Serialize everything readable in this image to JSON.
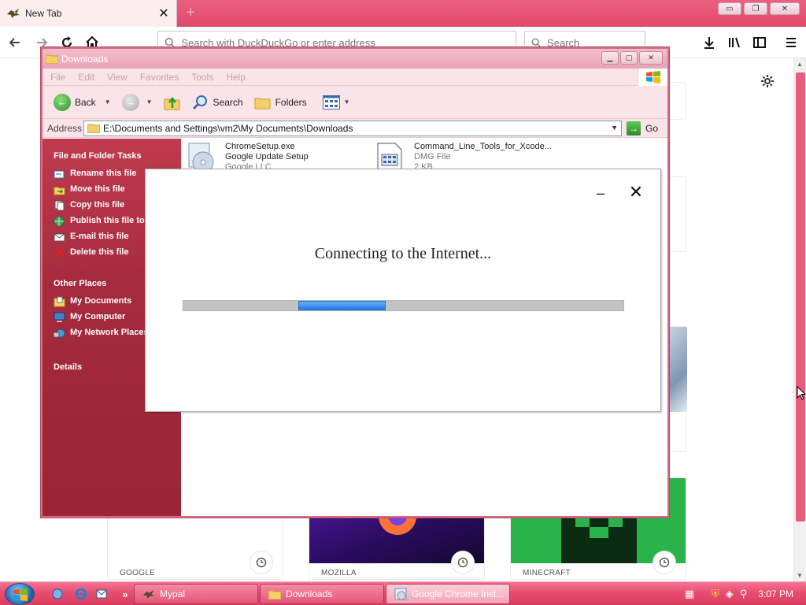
{
  "browser": {
    "tab_title": "New Tab",
    "tab_close": "✕",
    "new_tab": "+",
    "url_placeholder": "Search with DuckDuckGo or enter address",
    "search_placeholder": "Search",
    "window_controls": {
      "minimize": "▭",
      "restore": "❐",
      "close": "✕"
    }
  },
  "newtab": {
    "tiles": [
      {
        "label": "GOOGLE",
        "bg": "#ffffff"
      },
      {
        "label": "MOZILLA",
        "bg": "#3b1066"
      },
      {
        "label": "MINECRAFT",
        "bg": "#29b34a"
      }
    ]
  },
  "explorer": {
    "title": "Downloads",
    "menu": [
      "File",
      "Edit",
      "View",
      "Favorites",
      "Tools",
      "Help"
    ],
    "toolbar": {
      "back": "Back",
      "search": "Search",
      "folders": "Folders"
    },
    "address_label": "Address",
    "address_value": "E:\\Documents and Settings\\vm2\\My Documents\\Downloads",
    "go": "Go",
    "tasks_heading": "File and Folder Tasks",
    "tasks": [
      "Rename this file",
      "Move this file",
      "Copy this file",
      "Publish this file to the Web",
      "E-mail this file",
      "Delete this file"
    ],
    "other_places_heading": "Other Places",
    "other_places": [
      "My Documents",
      "My Computer",
      "My Network Places"
    ],
    "details_heading": "Details",
    "files": [
      {
        "name": "ChromeSetup.exe",
        "line2": "Google Update Setup",
        "line3": "Google LLC"
      },
      {
        "name": "Command_Line_Tools_for_Xcode...",
        "line2": "DMG File",
        "line3": "2 KB"
      }
    ]
  },
  "dialog": {
    "status": "Connecting to the Internet...",
    "minimize": "–",
    "close": "✕",
    "progress_start": 0.262,
    "progress_width": 0.198,
    "progress_color": "#1f7be0"
  },
  "taskbar": {
    "buttons": [
      {
        "label": "Mypal"
      },
      {
        "label": "Downloads"
      },
      {
        "label": "Google Chrome Inst..."
      }
    ],
    "overflow": "»",
    "clock": "3:07 PM"
  }
}
